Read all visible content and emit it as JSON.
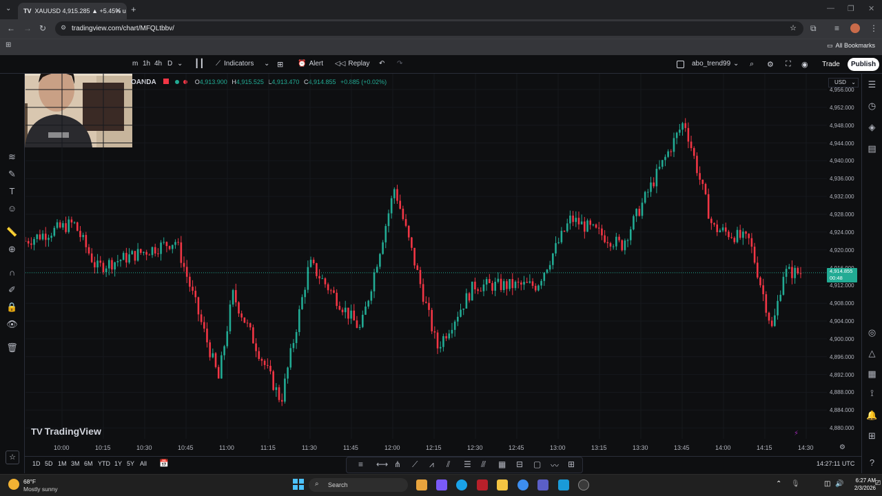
{
  "browser": {
    "tab_title": "XAUUSD 4,915.285 ▲ +5.45% u",
    "tab_prefix": "TV",
    "url": "tradingview.com/chart/MFQLtbbv/",
    "bookmarks_label": "All Bookmarks"
  },
  "toolbar": {
    "intervals": [
      "m",
      "1h",
      "4h",
      "D"
    ],
    "indicators_label": "Indicators",
    "alert_label": "Alert",
    "replay_label": "Replay",
    "layout_name": "abo_trend99",
    "trade_label": "Trade",
    "publish_label": "Publish"
  },
  "legend": {
    "symbol_suffix": "OANDA",
    "o_label": "O",
    "o_value": "4,913.900",
    "h_label": "H",
    "h_value": "4,915.525",
    "l_label": "L",
    "l_value": "4,913.470",
    "c_label": "C",
    "c_value": "4,914.855",
    "change": "+0.885 (+0.02%)"
  },
  "price_axis": {
    "currency": "USD",
    "labels": [
      "4,956.000",
      "4,952.000",
      "4,948.000",
      "4,944.000",
      "4,940.000",
      "4,936.000",
      "4,932.000",
      "4,928.000",
      "4,924.000",
      "4,920.000",
      "4,916.000",
      "4,912.000",
      "4,908.000",
      "4,904.000",
      "4,900.000",
      "4,896.000",
      "4,892.000",
      "4,888.000",
      "4,884.000",
      "4,880.000"
    ],
    "current_price": "4,914.855",
    "countdown": "00:48"
  },
  "time_axis": {
    "labels": [
      "10:00",
      "10:15",
      "10:30",
      "10:45",
      "11:00",
      "11:15",
      "11:30",
      "11:45",
      "12:00",
      "12:15",
      "12:30",
      "12:45",
      "13:00",
      "13:15",
      "13:30",
      "13:45",
      "14:00",
      "14:15",
      "14:30"
    ]
  },
  "bottom_bar": {
    "ranges": [
      "1D",
      "5D",
      "1M",
      "3M",
      "6M",
      "YTD",
      "1Y",
      "5Y",
      "All"
    ],
    "clock": "14:27:11 UTC"
  },
  "brand": {
    "logo_text": "TradingView"
  },
  "taskbar": {
    "weather_temp": "68°F",
    "weather_desc": "Mostly sunny",
    "search_label": "Search",
    "time": "6:27 AM",
    "date": "2/3/2026"
  },
  "chart_data": {
    "type": "candlestick",
    "symbol": "XAUUSD",
    "x_range": [
      "09:55",
      "14:28"
    ],
    "ylim": [
      4880,
      4958
    ],
    "up_color": "#22ab94",
    "down_color": "#f23645",
    "key_points": [
      {
        "time": "09:55",
        "price": 4922
      },
      {
        "time": "10:12",
        "price": 4926
      },
      {
        "time": "10:20",
        "price": 4916
      },
      {
        "time": "10:48",
        "price": 4922
      },
      {
        "time": "11:03",
        "price": 4891
      },
      {
        "time": "11:08",
        "price": 4910
      },
      {
        "time": "11:25",
        "price": 4886
      },
      {
        "time": "11:35",
        "price": 4917
      },
      {
        "time": "11:53",
        "price": 4902
      },
      {
        "time": "12:05",
        "price": 4934
      },
      {
        "time": "12:20",
        "price": 4898
      },
      {
        "time": "12:33",
        "price": 4912
      },
      {
        "time": "12:55",
        "price": 4912
      },
      {
        "time": "13:07",
        "price": 4927
      },
      {
        "time": "13:25",
        "price": 4921
      },
      {
        "time": "13:35",
        "price": 4934
      },
      {
        "time": "13:47",
        "price": 4949
      },
      {
        "time": "13:57",
        "price": 4925
      },
      {
        "time": "14:10",
        "price": 4922
      },
      {
        "time": "14:18",
        "price": 4902
      },
      {
        "time": "14:22",
        "price": 4915
      },
      {
        "time": "14:27",
        "price": 4914.855
      }
    ]
  },
  "colors": {
    "background": "#0e0f11",
    "accent_green": "#22ab94",
    "accent_red": "#f23645"
  }
}
